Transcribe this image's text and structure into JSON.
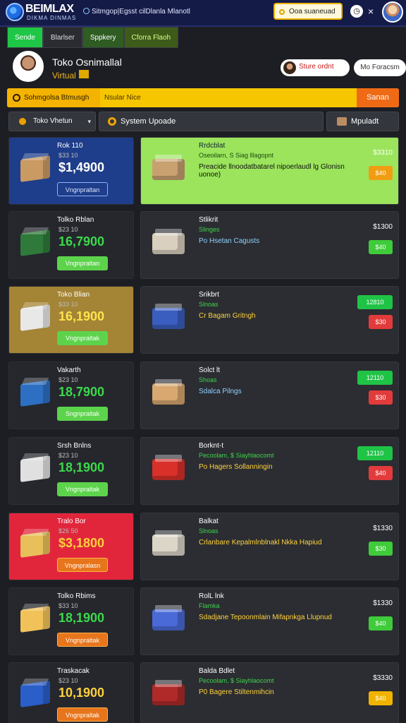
{
  "topbar": {
    "logo_main": "BEIMLAX",
    "logo_sub": "DIKMA DINMAS",
    "link": "Sitmgop|Egsst cilDlanla Mlanotl",
    "search_label": "Ooa suaneuad",
    "clock_icon": "clock-icon",
    "close_symbol": "×"
  },
  "tabs": [
    "Sende",
    "Blarlser",
    "Sppkery",
    "Cforra Flaoh"
  ],
  "profile": {
    "name": "Toko Osnimallal",
    "subtitle": "Virtual",
    "store_button": "Sture ordnt",
    "progress_button": "Mo Foracsm"
  },
  "notice": {
    "left": "Sohmgolsa Btmusgh",
    "middle": "Nsular Nice",
    "right": "Sanan"
  },
  "filters": {
    "store_select": "Toko Vhetun",
    "system": "System Upoade",
    "upload": "Mpuladt"
  },
  "colors": {
    "accent_green": "#1fc747",
    "accent_yellow": "#f6c600",
    "accent_orange": "#ef6a14",
    "topbar": "#151b47"
  },
  "rows": [
    {
      "left": {
        "name": "Rok 110",
        "sub": "$33 10",
        "price": "$1,4900",
        "button": "Vngnpraltan",
        "price_color": "#ffffff"
      },
      "right": {
        "title": "Rrdcblat",
        "sub": "Oseoilarn, S Siag lllagopnt",
        "desc": "Preacide llnoodatbatarel nipoerlaudl lg Glonisn uonoe)",
        "price": "$3310",
        "pill_top": "",
        "pill_bottom": "$40"
      }
    },
    {
      "left": {
        "name": "Tolko Rblan",
        "sub": "$23 10",
        "price": "16,7900",
        "button": "Vngnpraltan",
        "price_color": "#3bd94a"
      },
      "right": {
        "title": "Stlikrit",
        "sub": "Slinges",
        "desc": "Po Hsetan Cagusts",
        "price": "$1300",
        "pill_top": "",
        "pill_bottom": "$40"
      }
    },
    {
      "left": {
        "name": "Toko Blian",
        "sub": "$33 10",
        "price": "16,1900",
        "button": "Vngnpraltak",
        "price_color": "#ffe34d"
      },
      "right": {
        "title": "Srikbrt",
        "sub": "Slnoas",
        "desc": "Cr Bagam Gritngh",
        "price": "",
        "pill_top": "12810",
        "pill_bottom": "$30"
      }
    },
    {
      "left": {
        "name": "Vakarth",
        "sub": "$23 10",
        "price": "18,7900",
        "button": "Sngnpraltak",
        "price_color": "#3bd94a"
      },
      "right": {
        "title": "Solct lt",
        "sub": "Shoas",
        "desc": "Sdalca Pilngs",
        "price": "",
        "pill_top": "12110",
        "pill_bottom": "$30"
      }
    },
    {
      "left": {
        "name": "Srsh Bnlns",
        "sub": "$23 10",
        "price": "18,1900",
        "button": "Vngnpraltak",
        "price_color": "#3bd94a"
      },
      "right": {
        "title": "Borknt-t",
        "sub": "Pecoolam, $ Siayhlaocomt",
        "desc": "Po Hagers Sollanningin",
        "price": "",
        "pill_top": "12110",
        "pill_bottom": "$40"
      }
    },
    {
      "left": {
        "name": "Tralo Bor",
        "sub": "$26 50",
        "price": "$3,1800",
        "button": "Vngnpralasn",
        "price_color": "#ffd23a"
      },
      "right": {
        "title": "Balkat",
        "sub": "Slnoas",
        "desc": "Crlanbare Kepalmlnblnakl Nkka Hapiud",
        "price": "$1330",
        "pill_top": "",
        "pill_bottom": "$30"
      }
    },
    {
      "left": {
        "name": "Tolko Rbims",
        "sub": "$33 10",
        "price": "18,1900",
        "button": "Vngnpraltak",
        "price_color": "#3bd94a"
      },
      "right": {
        "title": "RolL lnk",
        "sub": "Flamka",
        "desc": "Sdadjane Tepoonmlain Mifapnkga Llupnud",
        "price": "$1330",
        "pill_top": "",
        "pill_bottom": "$40"
      }
    },
    {
      "left": {
        "name": "Traskacak",
        "sub": "$23 10",
        "price": "10,1900",
        "button": "Vngnpraltak",
        "price_color": "#ffd23a"
      },
      "right": {
        "title": "Balda Bdlet",
        "sub": "Pecoolam, $ Siayhlaocomt",
        "desc": "P0 Bagere Stiltenmihcin",
        "price": "$3330",
        "pill_top": "",
        "pill_bottom": "$40"
      }
    }
  ]
}
